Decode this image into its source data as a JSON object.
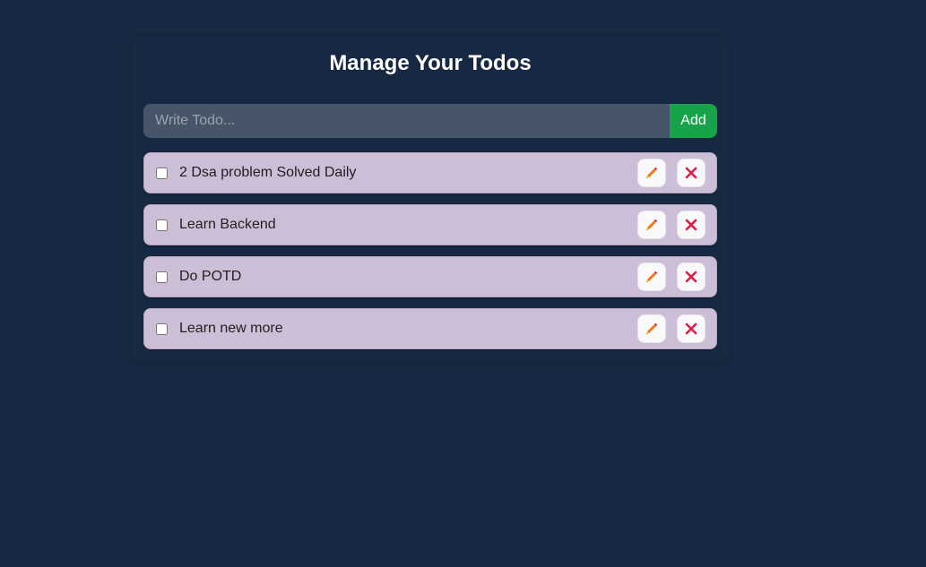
{
  "header": {
    "title": "Manage Your Todos"
  },
  "form": {
    "placeholder": "Write Todo...",
    "value": "",
    "add_label": "Add"
  },
  "todos": [
    {
      "text": "2 Dsa problem Solved Daily",
      "completed": false,
      "edit_icon": "pencil-icon",
      "delete_icon": "close-icon"
    },
    {
      "text": "Learn Backend",
      "completed": false,
      "edit_icon": "pencil-icon",
      "delete_icon": "close-icon"
    },
    {
      "text": "Do POTD",
      "completed": false,
      "edit_icon": "pencil-icon",
      "delete_icon": "close-icon"
    },
    {
      "text": "Learn new more",
      "completed": false,
      "edit_icon": "pencil-icon",
      "delete_icon": "close-icon"
    }
  ],
  "colors": {
    "background": "#172842",
    "input_bg": "#475569",
    "add_button": "#16a34a",
    "todo_bg": "#ccbed7",
    "delete_icon": "#e11d48",
    "edit_icon": "#f97316"
  }
}
